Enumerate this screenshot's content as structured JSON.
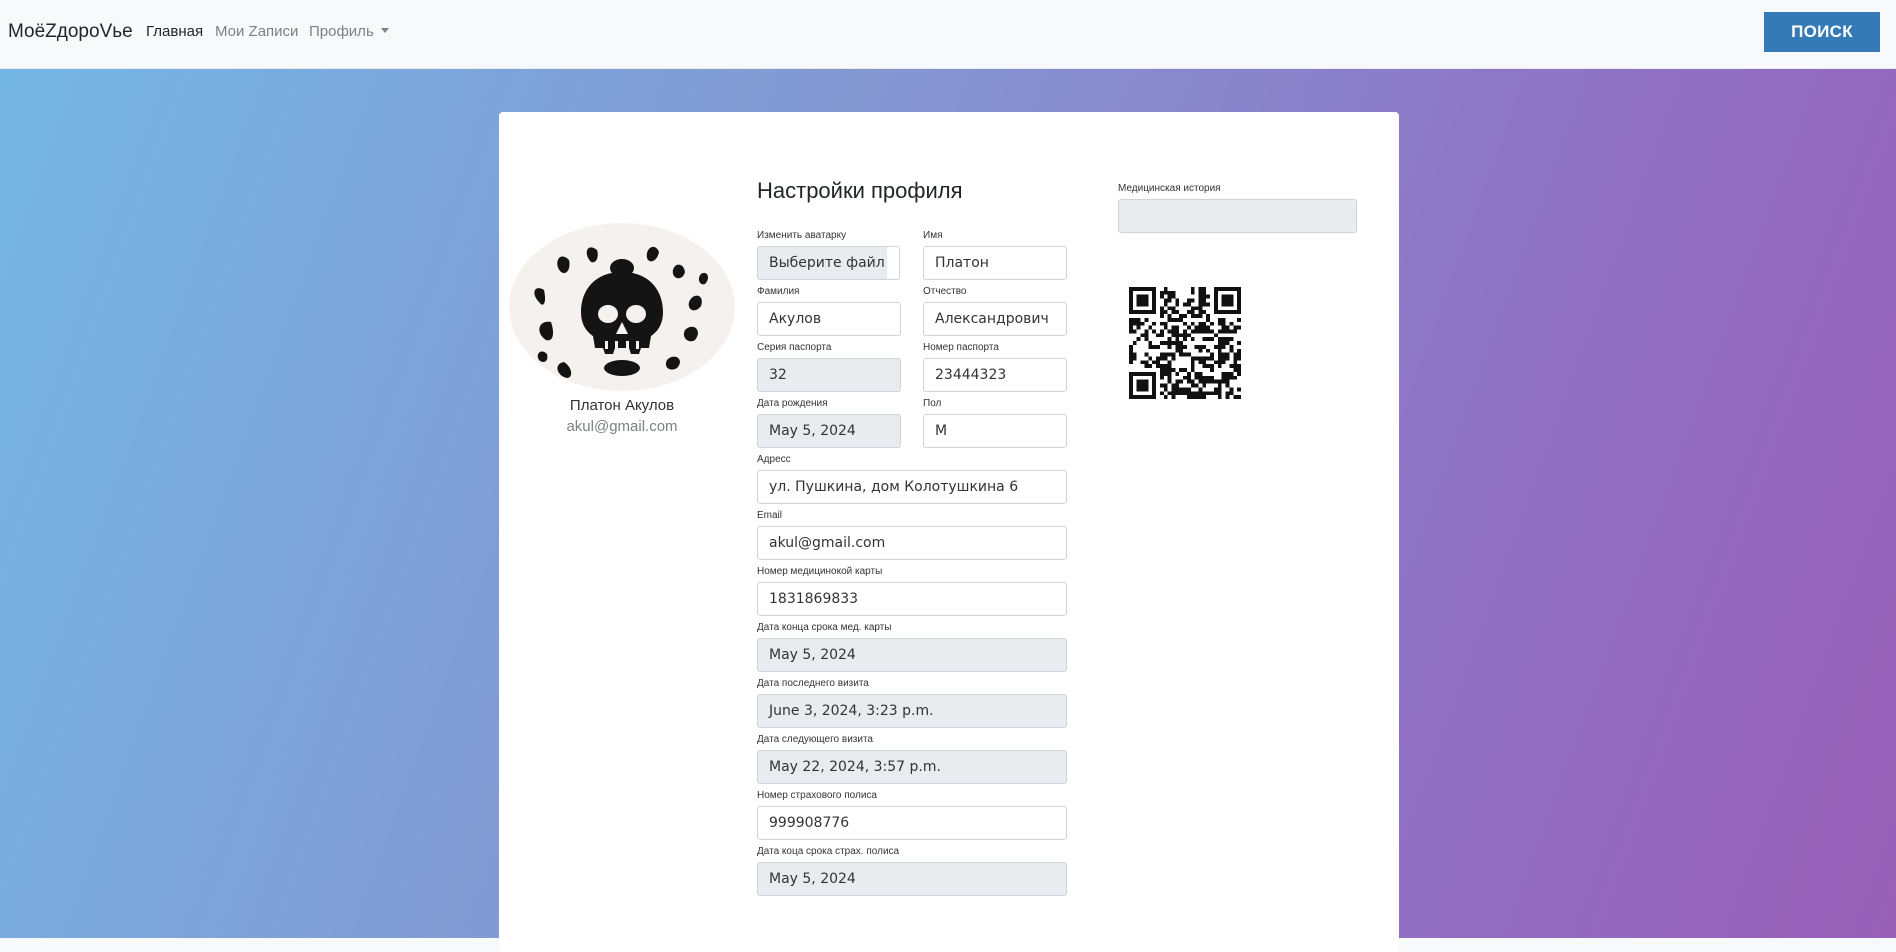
{
  "navbar": {
    "brand": "МоёZдороVье",
    "links": [
      "Главная",
      "Мои Zаписи",
      "Профиль"
    ],
    "search_label": "ПОИСК"
  },
  "profile_card": {
    "name": "Платон Акулов",
    "email": "akul@gmail.com"
  },
  "form": {
    "title": "Настройки профиля",
    "avatar_label": "Изменить аватарку",
    "avatar_button": "Выберите файл",
    "first_name_label": "Имя",
    "first_name": "Платон",
    "last_name_label": "Фамилия",
    "last_name": "Акулов",
    "patronymic_label": "Отчество",
    "patronymic": "Александрович",
    "passport_series_label": "Серия паспорта",
    "passport_series": "32",
    "passport_number_label": "Номер паспорта",
    "passport_number": "23444323",
    "birth_date_label": "Дата рождения",
    "birth_date": "May 5, 2024",
    "gender_label": "Пол",
    "gender": "M",
    "address_label": "Адресс",
    "address": "ул. Пушкина, дом Колотушкина 6",
    "email_label": "Email",
    "email": "akul@gmail.com",
    "med_card_label": "Номер медицинокой карты",
    "med_card": "1831869833",
    "med_card_end_label": "Дата конца срока мед. карты",
    "med_card_end": "May 5, 2024",
    "last_visit_label": "Дата последнего визита",
    "last_visit": "June 3, 2024, 3:23 p.m.",
    "next_visit_label": "Дата следующего визита",
    "next_visit": "May 22, 2024, 3:57 p.m.",
    "insurance_label": "Номер страхового полиса",
    "insurance": "999908776",
    "insurance_end_label": "Дата коца срока страх. полиса",
    "insurance_end": "May 5, 2024"
  },
  "side": {
    "history_label": "Медицинская история",
    "history_value": ""
  },
  "icons": {
    "avatar": "skull-avatar",
    "qr": "qr-code",
    "profile_menu": "caret-down-icon"
  },
  "colors": {
    "search_button": "#337ab7",
    "gradient_start": "#74b6e4",
    "gradient_end": "#9960b8"
  }
}
